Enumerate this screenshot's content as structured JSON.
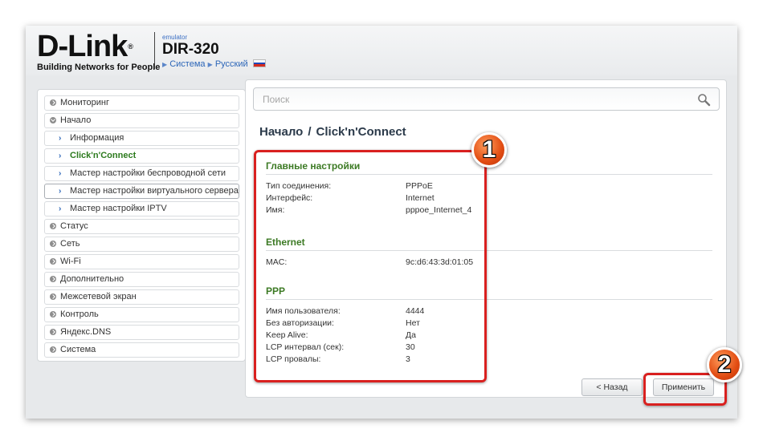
{
  "header": {
    "logo": "D-Link",
    "logo_reg": "®",
    "slogan": "Building Networks for People",
    "emulator": "emulator",
    "model": "DIR-320",
    "crumb_system": "Система",
    "crumb_language": "Русский",
    "flag_colors": [
      "#ffffff",
      "#1f47b8",
      "#d52b1e"
    ]
  },
  "sidebar": {
    "items": [
      {
        "label": "Мониторинг"
      },
      {
        "label": "Начало"
      },
      {
        "label": "Информация"
      },
      {
        "label": "Click'n'Connect"
      },
      {
        "label": "Мастер настройки беспроводной сети"
      },
      {
        "label": "Мастер настройки виртуального сервера"
      },
      {
        "label": "Мастер настройки IPTV"
      },
      {
        "label": "Статус"
      },
      {
        "label": "Сеть"
      },
      {
        "label": "Wi-Fi"
      },
      {
        "label": "Дополнительно"
      },
      {
        "label": "Межсетевой экран"
      },
      {
        "label": "Контроль"
      },
      {
        "label": "Яндекс.DNS"
      },
      {
        "label": "Система"
      }
    ]
  },
  "search": {
    "placeholder": "Поиск"
  },
  "page": {
    "title_parent": "Начало",
    "title_sep": "/",
    "title_current": "Click'n'Connect"
  },
  "main_settings": {
    "title": "Главные настройки",
    "rows": [
      {
        "label": "Тип соединения:",
        "value": "PPPoE"
      },
      {
        "label": "Интерфейс:",
        "value": "Internet"
      },
      {
        "label": "Имя:",
        "value": "pppoe_Internet_4"
      }
    ]
  },
  "ethernet": {
    "title": "Ethernet",
    "rows": [
      {
        "label": "MAC:",
        "value": "9c:d6:43:3d:01:05"
      }
    ]
  },
  "ppp": {
    "title": "PPP",
    "rows": [
      {
        "label": "Имя пользователя:",
        "value": "4444"
      },
      {
        "label": "Без авторизации:",
        "value": "Нет"
      },
      {
        "label": "Keep Alive:",
        "value": "Да"
      },
      {
        "label": "LCP интервал (сек):",
        "value": "30"
      },
      {
        "label": "LCP провалы:",
        "value": "3"
      }
    ]
  },
  "buttons": {
    "back": "< Назад",
    "apply": "Применить"
  },
  "annotations": {
    "badge_1": "1",
    "badge_2": "2",
    "highlight_color": "#d9201f"
  }
}
